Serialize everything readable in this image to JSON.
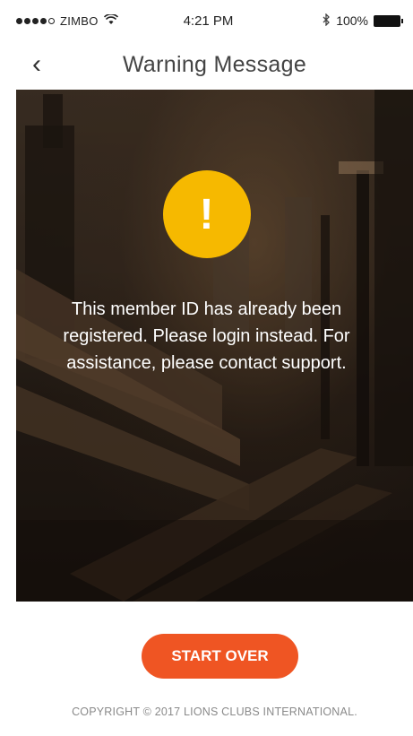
{
  "status_bar": {
    "carrier": "ZIMBO",
    "time": "4:21 PM",
    "battery": "100%",
    "signal_icon": "signal-dots-icon",
    "wifi_icon": "wifi-icon",
    "bluetooth_icon": "bluetooth-icon",
    "battery_icon": "battery-icon"
  },
  "nav": {
    "back_icon": "chevron-left-icon",
    "back_glyph": "‹",
    "title": "Warning Message"
  },
  "warning": {
    "icon": "exclamation-icon",
    "icon_glyph": "!",
    "icon_color": "#f6b900",
    "message": "This member ID has already been registered. Please login instead. For assistance, please contact support."
  },
  "actions": {
    "start_over_label": "START OVER",
    "accent_color": "#ef5523"
  },
  "footer": {
    "copyright": "COPYRIGHT © 2017 LIONS CLUBS INTERNATIONAL."
  }
}
